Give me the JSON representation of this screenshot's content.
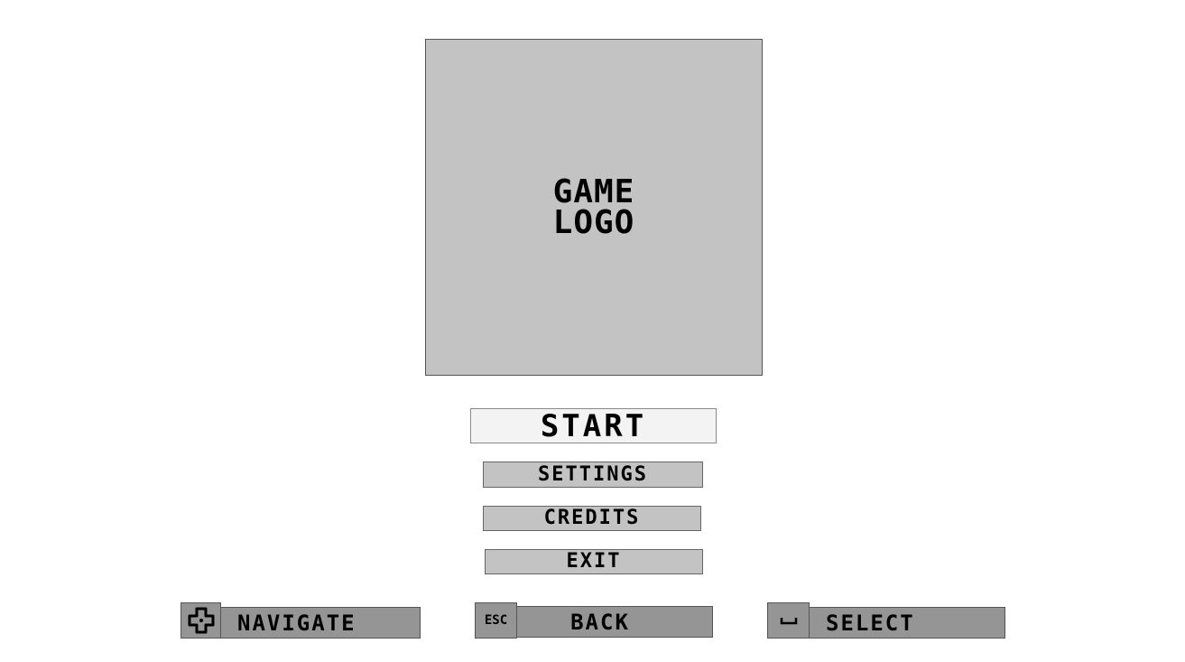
{
  "logo": {
    "text": "GAME\nLOGO"
  },
  "menu": {
    "items": [
      {
        "label": "START",
        "selected": true
      },
      {
        "label": "SETTINGS"
      },
      {
        "label": "CREDITS"
      },
      {
        "label": "EXIT"
      }
    ]
  },
  "hints": [
    {
      "icon": "dpad-icon",
      "label": "NAVIGATE"
    },
    {
      "key": "ESC",
      "label": "BACK"
    },
    {
      "icon": "spacebar-icon",
      "key": "␣",
      "label": "SELECT"
    }
  ]
}
